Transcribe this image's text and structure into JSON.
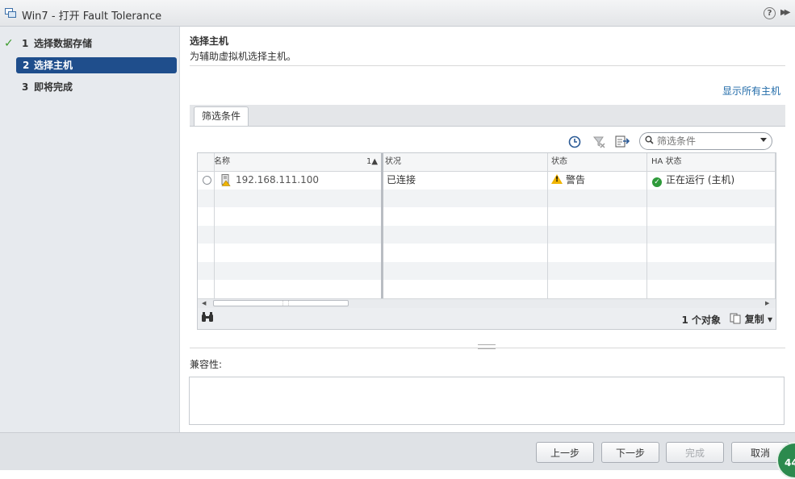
{
  "window": {
    "title": "Win7 - 打开 Fault Tolerance",
    "help_icon": "?"
  },
  "steps": [
    {
      "num": "1",
      "label": "选择数据存储",
      "state": "done"
    },
    {
      "num": "2",
      "label": "选择主机",
      "state": "active"
    },
    {
      "num": "3",
      "label": "即将完成",
      "state": "pending"
    }
  ],
  "page": {
    "title": "选择主机",
    "description": "为辅助虚拟机选择主机。",
    "show_all_hosts_link": "显示所有主机",
    "filter_tab": "筛选条件",
    "filter_placeholder": "筛选条件"
  },
  "table": {
    "columns": [
      "名称",
      "状况",
      "状态",
      "HA 状态"
    ],
    "sort_indicator": "1▲",
    "rows": [
      {
        "name": "192.168.111.100",
        "condition": "已连接",
        "status": "警告",
        "ha_status": "正在运行 (主机)"
      }
    ],
    "object_count": "1 个对象",
    "copy_label": "复制"
  },
  "compatibility": {
    "label": "兼容性:"
  },
  "buttons": {
    "back": "上一步",
    "next": "下一步",
    "finish": "完成",
    "cancel": "取消"
  },
  "badge": {
    "text": "44"
  },
  "colors": {
    "active_step": "#1f4e8c",
    "link": "#1f6aa8",
    "check": "#3a9a2a",
    "ok": "#2e9a3a",
    "warning": "#f0b400"
  }
}
